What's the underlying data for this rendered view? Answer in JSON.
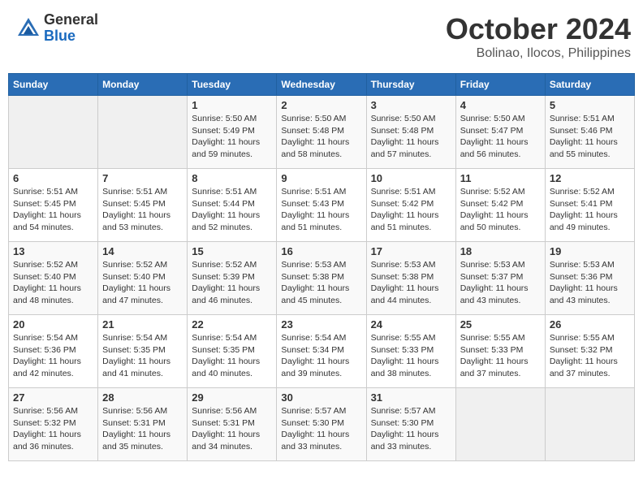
{
  "header": {
    "logo_general": "General",
    "logo_blue": "Blue",
    "title": "October 2024",
    "location": "Bolinao, Ilocos, Philippines"
  },
  "weekdays": [
    "Sunday",
    "Monday",
    "Tuesday",
    "Wednesday",
    "Thursday",
    "Friday",
    "Saturday"
  ],
  "weeks": [
    [
      {
        "day": "",
        "sunrise": "",
        "sunset": "",
        "daylight": ""
      },
      {
        "day": "",
        "sunrise": "",
        "sunset": "",
        "daylight": ""
      },
      {
        "day": "1",
        "sunrise": "Sunrise: 5:50 AM",
        "sunset": "Sunset: 5:49 PM",
        "daylight": "Daylight: 11 hours and 59 minutes."
      },
      {
        "day": "2",
        "sunrise": "Sunrise: 5:50 AM",
        "sunset": "Sunset: 5:48 PM",
        "daylight": "Daylight: 11 hours and 58 minutes."
      },
      {
        "day": "3",
        "sunrise": "Sunrise: 5:50 AM",
        "sunset": "Sunset: 5:48 PM",
        "daylight": "Daylight: 11 hours and 57 minutes."
      },
      {
        "day": "4",
        "sunrise": "Sunrise: 5:50 AM",
        "sunset": "Sunset: 5:47 PM",
        "daylight": "Daylight: 11 hours and 56 minutes."
      },
      {
        "day": "5",
        "sunrise": "Sunrise: 5:51 AM",
        "sunset": "Sunset: 5:46 PM",
        "daylight": "Daylight: 11 hours and 55 minutes."
      }
    ],
    [
      {
        "day": "6",
        "sunrise": "Sunrise: 5:51 AM",
        "sunset": "Sunset: 5:45 PM",
        "daylight": "Daylight: 11 hours and 54 minutes."
      },
      {
        "day": "7",
        "sunrise": "Sunrise: 5:51 AM",
        "sunset": "Sunset: 5:45 PM",
        "daylight": "Daylight: 11 hours and 53 minutes."
      },
      {
        "day": "8",
        "sunrise": "Sunrise: 5:51 AM",
        "sunset": "Sunset: 5:44 PM",
        "daylight": "Daylight: 11 hours and 52 minutes."
      },
      {
        "day": "9",
        "sunrise": "Sunrise: 5:51 AM",
        "sunset": "Sunset: 5:43 PM",
        "daylight": "Daylight: 11 hours and 51 minutes."
      },
      {
        "day": "10",
        "sunrise": "Sunrise: 5:51 AM",
        "sunset": "Sunset: 5:42 PM",
        "daylight": "Daylight: 11 hours and 51 minutes."
      },
      {
        "day": "11",
        "sunrise": "Sunrise: 5:52 AM",
        "sunset": "Sunset: 5:42 PM",
        "daylight": "Daylight: 11 hours and 50 minutes."
      },
      {
        "day": "12",
        "sunrise": "Sunrise: 5:52 AM",
        "sunset": "Sunset: 5:41 PM",
        "daylight": "Daylight: 11 hours and 49 minutes."
      }
    ],
    [
      {
        "day": "13",
        "sunrise": "Sunrise: 5:52 AM",
        "sunset": "Sunset: 5:40 PM",
        "daylight": "Daylight: 11 hours and 48 minutes."
      },
      {
        "day": "14",
        "sunrise": "Sunrise: 5:52 AM",
        "sunset": "Sunset: 5:40 PM",
        "daylight": "Daylight: 11 hours and 47 minutes."
      },
      {
        "day": "15",
        "sunrise": "Sunrise: 5:52 AM",
        "sunset": "Sunset: 5:39 PM",
        "daylight": "Daylight: 11 hours and 46 minutes."
      },
      {
        "day": "16",
        "sunrise": "Sunrise: 5:53 AM",
        "sunset": "Sunset: 5:38 PM",
        "daylight": "Daylight: 11 hours and 45 minutes."
      },
      {
        "day": "17",
        "sunrise": "Sunrise: 5:53 AM",
        "sunset": "Sunset: 5:38 PM",
        "daylight": "Daylight: 11 hours and 44 minutes."
      },
      {
        "day": "18",
        "sunrise": "Sunrise: 5:53 AM",
        "sunset": "Sunset: 5:37 PM",
        "daylight": "Daylight: 11 hours and 43 minutes."
      },
      {
        "day": "19",
        "sunrise": "Sunrise: 5:53 AM",
        "sunset": "Sunset: 5:36 PM",
        "daylight": "Daylight: 11 hours and 43 minutes."
      }
    ],
    [
      {
        "day": "20",
        "sunrise": "Sunrise: 5:54 AM",
        "sunset": "Sunset: 5:36 PM",
        "daylight": "Daylight: 11 hours and 42 minutes."
      },
      {
        "day": "21",
        "sunrise": "Sunrise: 5:54 AM",
        "sunset": "Sunset: 5:35 PM",
        "daylight": "Daylight: 11 hours and 41 minutes."
      },
      {
        "day": "22",
        "sunrise": "Sunrise: 5:54 AM",
        "sunset": "Sunset: 5:35 PM",
        "daylight": "Daylight: 11 hours and 40 minutes."
      },
      {
        "day": "23",
        "sunrise": "Sunrise: 5:54 AM",
        "sunset": "Sunset: 5:34 PM",
        "daylight": "Daylight: 11 hours and 39 minutes."
      },
      {
        "day": "24",
        "sunrise": "Sunrise: 5:55 AM",
        "sunset": "Sunset: 5:33 PM",
        "daylight": "Daylight: 11 hours and 38 minutes."
      },
      {
        "day": "25",
        "sunrise": "Sunrise: 5:55 AM",
        "sunset": "Sunset: 5:33 PM",
        "daylight": "Daylight: 11 hours and 37 minutes."
      },
      {
        "day": "26",
        "sunrise": "Sunrise: 5:55 AM",
        "sunset": "Sunset: 5:32 PM",
        "daylight": "Daylight: 11 hours and 37 minutes."
      }
    ],
    [
      {
        "day": "27",
        "sunrise": "Sunrise: 5:56 AM",
        "sunset": "Sunset: 5:32 PM",
        "daylight": "Daylight: 11 hours and 36 minutes."
      },
      {
        "day": "28",
        "sunrise": "Sunrise: 5:56 AM",
        "sunset": "Sunset: 5:31 PM",
        "daylight": "Daylight: 11 hours and 35 minutes."
      },
      {
        "day": "29",
        "sunrise": "Sunrise: 5:56 AM",
        "sunset": "Sunset: 5:31 PM",
        "daylight": "Daylight: 11 hours and 34 minutes."
      },
      {
        "day": "30",
        "sunrise": "Sunrise: 5:57 AM",
        "sunset": "Sunset: 5:30 PM",
        "daylight": "Daylight: 11 hours and 33 minutes."
      },
      {
        "day": "31",
        "sunrise": "Sunrise: 5:57 AM",
        "sunset": "Sunset: 5:30 PM",
        "daylight": "Daylight: 11 hours and 33 minutes."
      },
      {
        "day": "",
        "sunrise": "",
        "sunset": "",
        "daylight": ""
      },
      {
        "day": "",
        "sunrise": "",
        "sunset": "",
        "daylight": ""
      }
    ]
  ]
}
